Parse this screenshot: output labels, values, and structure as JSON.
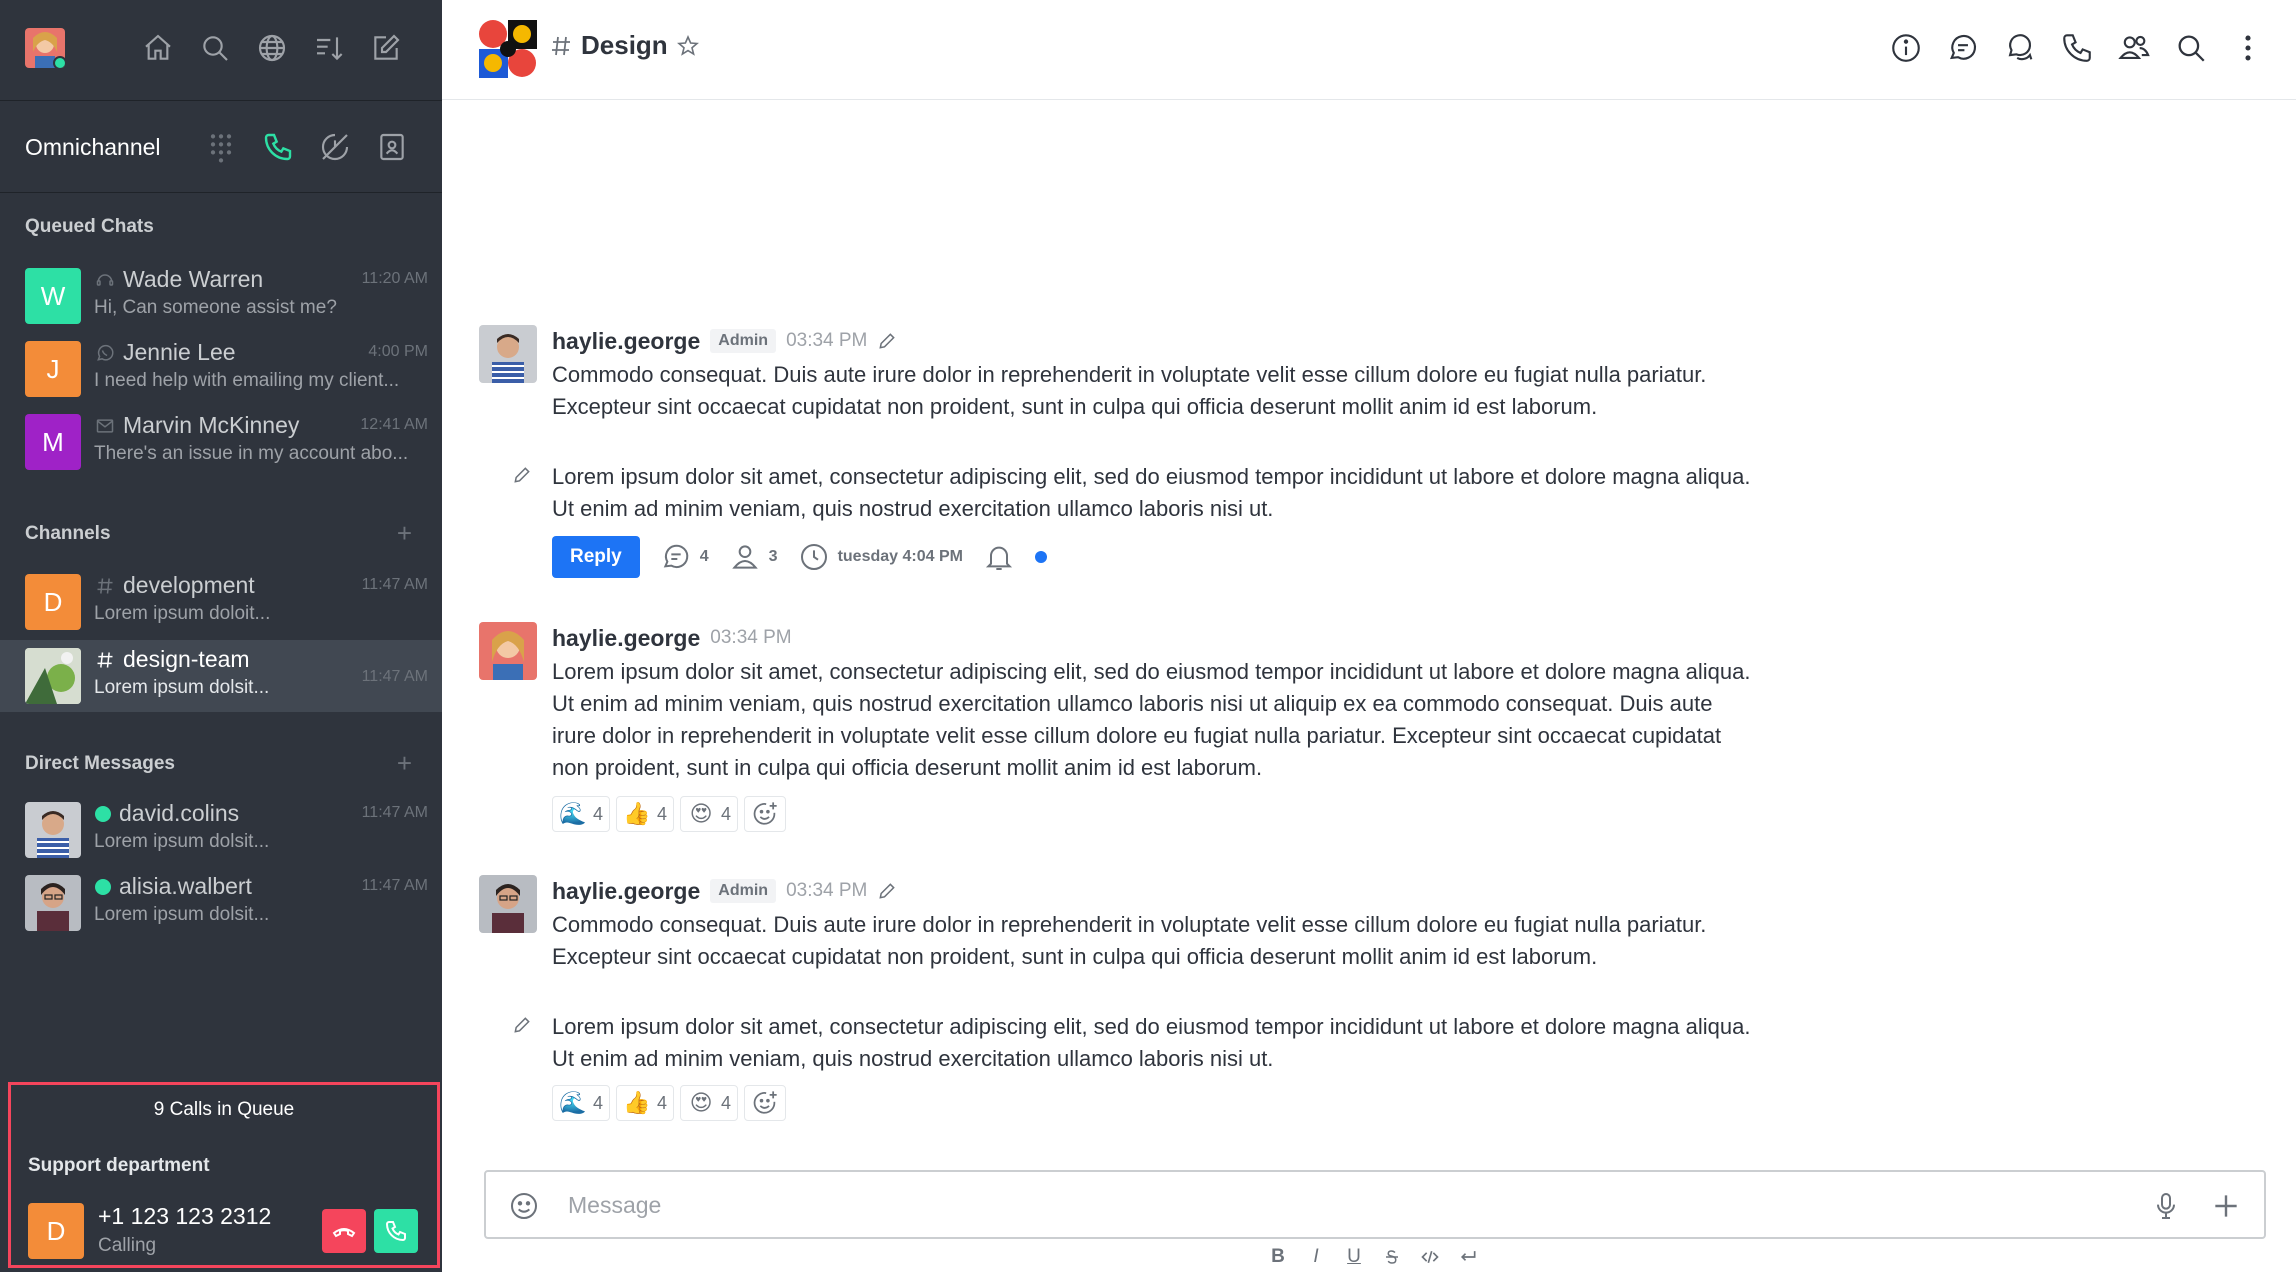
{
  "sidebar": {
    "omnichannel_label": "Omnichannel",
    "queued_title": "Queued Chats",
    "queued": [
      {
        "initial": "W",
        "name": "Wade Warren",
        "message": "Hi, Can someone assist me?",
        "time": "11:20 AM",
        "color": "#2de0a5",
        "channel_icon": "livechat-icon"
      },
      {
        "initial": "J",
        "name": "Jennie Lee",
        "message": "I need help with emailing my client...",
        "time": "4:00 PM",
        "color": "#f38c39",
        "channel_icon": "whatsapp-icon"
      },
      {
        "initial": "M",
        "name": "Marvin McKinney",
        "message": "There's an issue in my account abo...",
        "time": "12:41 AM",
        "color": "#9f22c7",
        "channel_icon": "email-icon"
      }
    ],
    "channels_title": "Channels",
    "channels": [
      {
        "initial": "D",
        "name": "development",
        "message": "Lorem ipsum doloit...",
        "time": "11:47 AM",
        "color": "#f38c39"
      },
      {
        "name": "design-team",
        "message": "Lorem ipsum dolsit...",
        "time": "11:47 AM"
      }
    ],
    "dm_title": "Direct Messages",
    "dms": [
      {
        "name": "david.colins",
        "message": "Lorem ipsum dolsit...",
        "time": "11:47 AM"
      },
      {
        "name": "alisia.walbert",
        "message": "Lorem ipsum dolsit...",
        "time": "11:47 AM"
      }
    ],
    "queue": {
      "title": "9 Calls in Queue",
      "department": "Support department",
      "caller_initial": "D",
      "caller_number": "+1 123 123 2312",
      "caller_status": "Calling"
    }
  },
  "header": {
    "room_name": "Design"
  },
  "messages": [
    {
      "user": "haylie.george",
      "role": "Admin",
      "time": "03:34 PM",
      "text1": "Commodo consequat. Duis aute irure dolor in reprehenderit in voluptate velit esse cillum dolore eu fugiat nulla pariatur. Excepteur sint occaecat cupidatat non proident, sunt in culpa qui officia deserunt mollit anim id est laborum.",
      "text2": "Lorem ipsum dolor sit amet, consectetur adipiscing elit, sed do eiusmod tempor incididunt ut labore et dolore magna aliqua. Ut enim ad minim veniam, quis nostrud exercitation ullamco laboris nisi ut.",
      "thread": {
        "reply_label": "Reply",
        "replies": "4",
        "participants": "3",
        "last": "tuesday 4:04 PM"
      }
    },
    {
      "user": "haylie.george",
      "time": "03:34 PM",
      "text1": "Lorem ipsum dolor sit amet, consectetur adipiscing elit, sed do eiusmod tempor incididunt ut labore et dolore magna aliqua. Ut enim ad minim veniam, quis nostrud exercitation ullamco laboris nisi ut aliquip ex ea commodo consequat. Duis aute irure dolor in reprehenderit in voluptate velit esse cillum dolore eu fugiat nulla pariatur. Excepteur sint occaecat cupidatat non proident, sunt in culpa qui officia deserunt mollit anim id est laborum.",
      "reactions": [
        {
          "emoji": "🌊",
          "count": "4"
        },
        {
          "emoji": "👍",
          "count": "4"
        },
        {
          "emoji": "😍",
          "count": "4"
        }
      ]
    },
    {
      "user": "haylie.george",
      "role": "Admin",
      "time": "03:34 PM",
      "text1": "Commodo consequat. Duis aute irure dolor in reprehenderit in voluptate velit esse cillum dolore eu fugiat nulla pariatur. Excepteur sint occaecat cupidatat non proident, sunt in culpa qui officia deserunt mollit anim id est laborum.",
      "text2": "Lorem ipsum dolor sit amet, consectetur adipiscing elit, sed do eiusmod tempor incididunt ut labore et dolore magna aliqua. Ut enim ad minim veniam, quis nostrud exercitation ullamco laboris nisi ut.",
      "reactions": [
        {
          "emoji": "🌊",
          "count": "4"
        },
        {
          "emoji": "👍",
          "count": "4"
        },
        {
          "emoji": "😍",
          "count": "4"
        }
      ]
    }
  ],
  "composer": {
    "placeholder": "Message"
  },
  "format_labels": {
    "bold": "B",
    "italic": "I",
    "underline": "U"
  },
  "colors": {
    "accent": "#1d74f5",
    "online": "#2de0a5",
    "danger": "#f5455c",
    "sidebar": "#2f343d"
  }
}
